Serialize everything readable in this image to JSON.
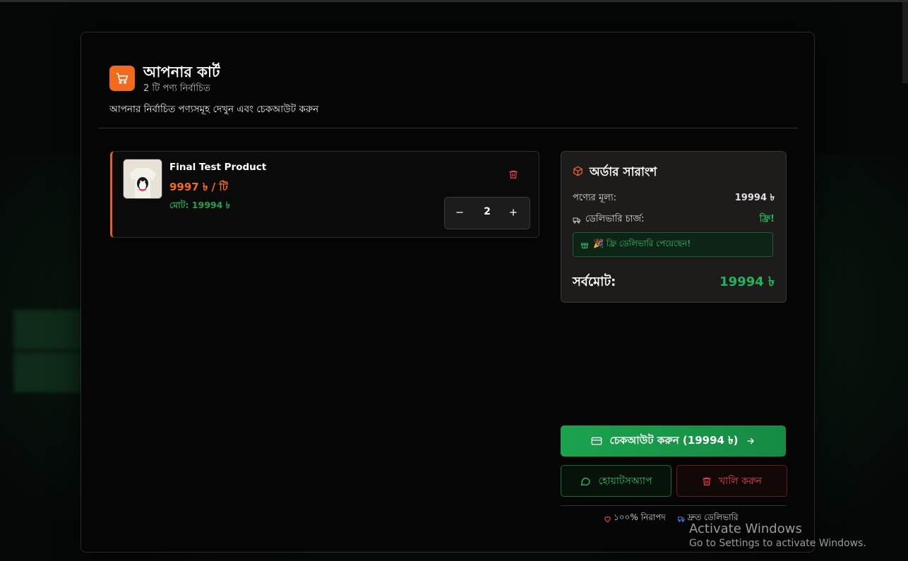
{
  "cart": {
    "title": "আপনার কার্ট",
    "count_text": "2 টি পণ্য নির্বাচিত",
    "description": "আপনার নির্বাচিত পণ্যসমূহ দেখুন এবং চেকআউট করুন",
    "accent_color": "#f26b1d"
  },
  "items": [
    {
      "name": "Final Test Product",
      "unit_price": "9997 ৳ / টি",
      "total": "মোট: 19994 ৳",
      "quantity": "2"
    }
  ],
  "summary": {
    "title": "অর্ডার সারাংশ",
    "product_price_label": "পণ্যের মূল্য:",
    "product_price_value": "19994 ৳",
    "delivery_label": "ডেলিভারি চার্জ:",
    "delivery_value": "ফ্রি!",
    "free_banner": "🎉 ফ্রি ডেলিভারি পেয়েছেন!",
    "grand_total_label": "সর্বমোট:",
    "grand_total_value": "19994 ৳"
  },
  "actions": {
    "checkout_label": "চেকআউট করুন (19994 ৳)",
    "whatsapp_label": "হোয়াটসঅ্যাপ",
    "clear_label": "খালি করুন"
  },
  "footer": {
    "secure": "১০০% নিরাপদ",
    "fast_delivery": "দ্রুত ডেলিভারি"
  },
  "os_watermark": {
    "line1": "Activate Windows",
    "line2": "Go to Settings to activate Windows."
  }
}
